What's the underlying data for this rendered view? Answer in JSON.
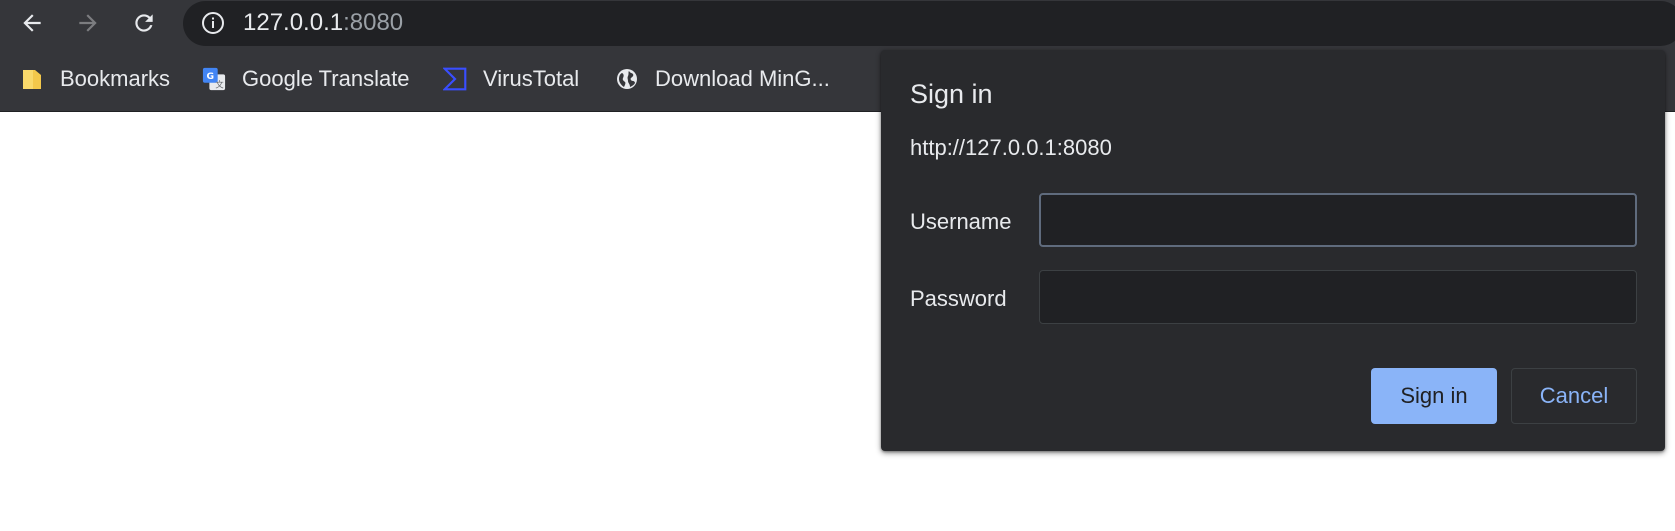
{
  "browser": {
    "nav": {
      "back_icon": "arrow-left-icon",
      "forward_icon": "arrow-right-icon",
      "reload_icon": "reload-icon"
    },
    "omnibox": {
      "info_icon": "info-circle-icon",
      "host": "127.0.0.1",
      "port": ":8080"
    },
    "bookmarks": [
      {
        "label": "Bookmarks",
        "icon": "folder-icon"
      },
      {
        "label": "Google Translate",
        "icon": "google-translate-icon"
      },
      {
        "label": "VirusTotal",
        "icon": "virustotal-icon"
      },
      {
        "label": "Download MinG...",
        "icon": "globe-icon"
      }
    ]
  },
  "dialog": {
    "title": "Sign in",
    "origin": "http://127.0.0.1:8080",
    "username_label": "Username",
    "username_value": "",
    "password_label": "Password",
    "password_value": "",
    "sign_in_label": "Sign in",
    "cancel_label": "Cancel"
  },
  "colors": {
    "toolbar": "#35363a",
    "omnibox": "#202124",
    "dialog": "#292a2d",
    "accent": "#8ab4f8",
    "text": "#e8eaed"
  }
}
